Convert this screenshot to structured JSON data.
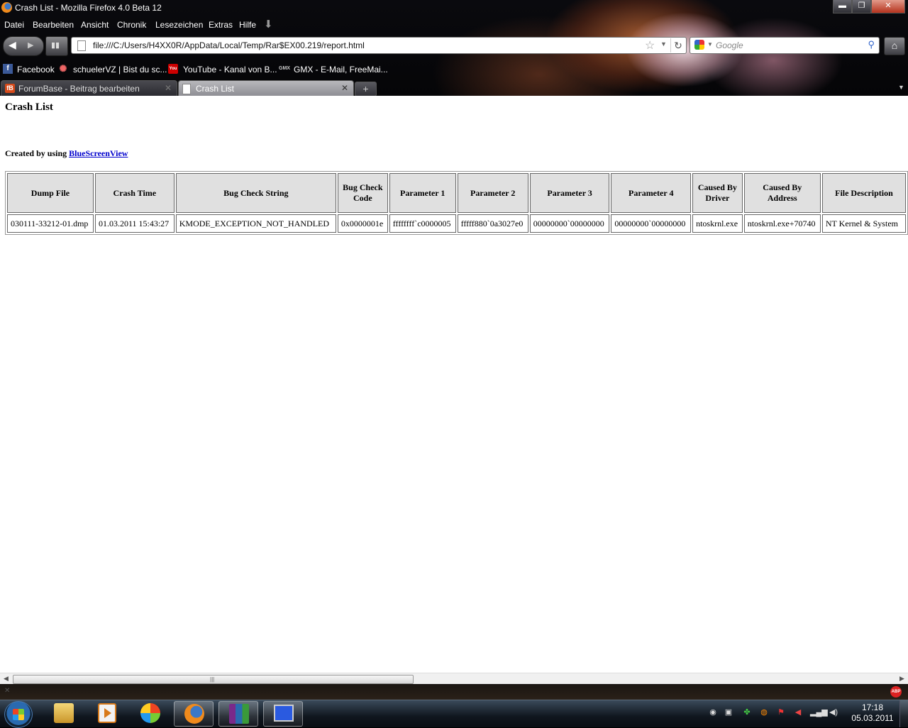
{
  "window": {
    "title": "Crash List - Mozilla Firefox 4.0 Beta 12",
    "minimize": "▬",
    "maximize": "❐",
    "close": "✕"
  },
  "menu": [
    "Datei",
    "Bearbeiten",
    "Ansicht",
    "Chronik",
    "Lesezeichen",
    "Extras",
    "Hilfe"
  ],
  "toolbar": {
    "url": "file:///C:/Users/H4XX0R/AppData/Local/Temp/Rar$EX00.219/report.html",
    "search_placeholder": "Google"
  },
  "bookmarks": [
    {
      "label": "Facebook",
      "icon": "facebook-icon"
    },
    {
      "label": "schuelerVZ | Bist du sc...",
      "icon": "schuelervz-icon"
    },
    {
      "label": "YouTube - Kanal von B...",
      "icon": "youtube-icon"
    },
    {
      "label": "GMX - E-Mail, FreeMai...",
      "icon": "gmx-icon"
    }
  ],
  "tabs": [
    {
      "label": "ForumBase - Beitrag bearbeiten",
      "active": false
    },
    {
      "label": "Crash List",
      "active": true
    }
  ],
  "page": {
    "heading": "Crash List",
    "created_prefix": "Created by using",
    "created_link": "BlueScreenView",
    "table": {
      "headers": [
        "Dump File",
        "Crash Time",
        "Bug Check String",
        "Bug Check Code",
        "Parameter 1",
        "Parameter 2",
        "Parameter 3",
        "Parameter 4",
        "Caused By Driver",
        "Caused By Address",
        "File Description"
      ],
      "rows": [
        [
          "030111-33212-01.dmp",
          "01.03.2011 15:43:27",
          "KMODE_EXCEPTION_NOT_HANDLED",
          "0x0000001e",
          "ffffffff`c0000005",
          "fffff880`0a3027e0",
          "00000000`00000000",
          "00000000`00000000",
          "ntoskrnl.exe",
          "ntoskrnl.exe+70740",
          "NT Kernel & System"
        ]
      ]
    }
  },
  "taskbar": {
    "time": "17:18",
    "date": "05.03.2011"
  },
  "colors": {
    "link": "#0000cc",
    "header_bg": "#e0e0e0"
  }
}
